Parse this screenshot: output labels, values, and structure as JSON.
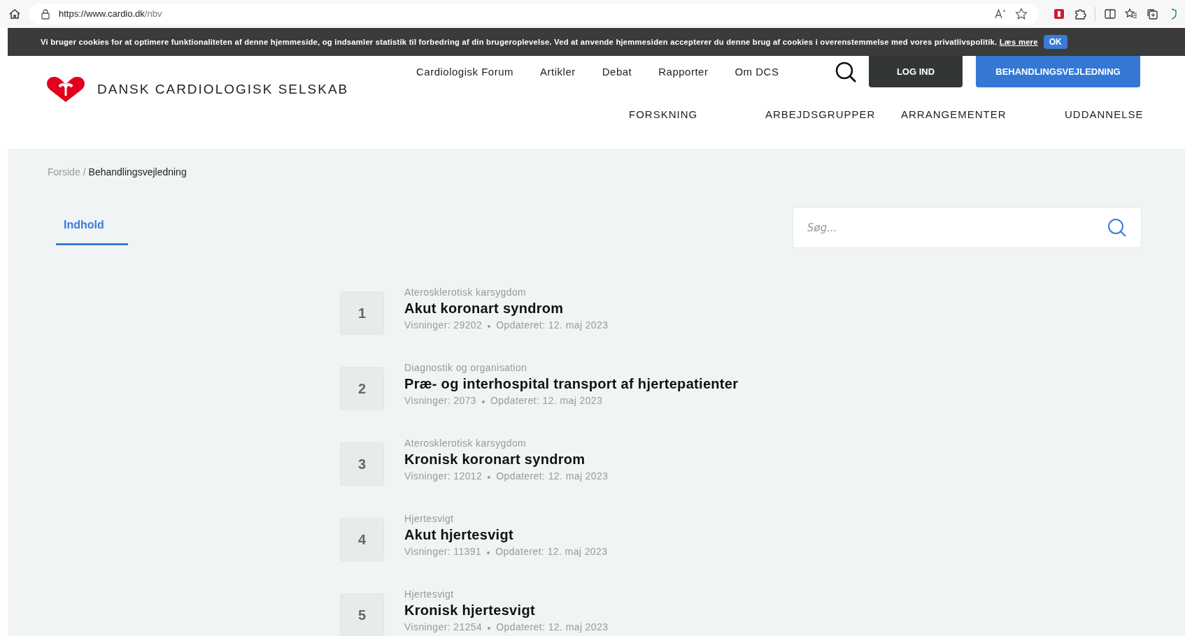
{
  "browser": {
    "url_prefix": "https://www.cardio.dk",
    "url_path": "/nbv"
  },
  "cookie_bar": {
    "text": "Vi bruger cookies for at optimere funktionaliteten af denne hjemmeside, og indsamler statistik til forbedring af din brugeroplevelse. Ved at anvende hjemmesiden accepterer du denne brug af cookies i overenstemmelse med vores privatlivspolitik.",
    "link": "Læs mere",
    "button": "OK"
  },
  "header": {
    "logo_text": "DANSK CARDIOLOGISK SELSKAB",
    "top_nav": [
      "Cardiologisk Forum",
      "Artikler",
      "Debat",
      "Rapporter",
      "Om DCS"
    ],
    "login_button": "LOG IND",
    "primary_button": "BEHANDLINGSVEJLEDNING",
    "main_nav": [
      "FORSKNING",
      "ARBEJDSGRUPPER",
      "ARRANGEMENTER",
      "UDDANNELSE"
    ]
  },
  "breadcrumb": [
    {
      "label": "Forside",
      "current": false
    },
    {
      "label": "Behandlingsvejledning",
      "current": true
    }
  ],
  "breadcrumb_separator": "/",
  "tabs": [
    {
      "label": "Indhold",
      "selected": true
    }
  ],
  "search": {
    "placeholder": "Søg..."
  },
  "guidelines": [
    {
      "number": "1",
      "category": "Aterosklerotisk karsygdom",
      "title": "Akut koronart syndrom",
      "views": "Visninger: 29202",
      "updated": "Opdateret: 12. maj 2023"
    },
    {
      "number": "2",
      "category": "Diagnostik og organisation",
      "title": "Præ- og interhospital transport af hjertepatienter",
      "views": "Visninger: 2073",
      "updated": "Opdateret: 12. maj 2023"
    },
    {
      "number": "3",
      "category": "Aterosklerotisk karsygdom",
      "title": "Kronisk koronart syndrom",
      "views": "Visninger: 12012",
      "updated": "Opdateret: 12. maj 2023"
    },
    {
      "number": "4",
      "category": "Hjertesvigt",
      "title": "Akut hjertesvigt",
      "views": "Visninger: 11391",
      "updated": "Opdateret: 12. maj 2023"
    },
    {
      "number": "5",
      "category": "Hjertesvigt",
      "title": "Kronisk hjertesvigt",
      "views": "Visninger: 21254",
      "updated": "Opdateret: 12. maj 2023"
    }
  ]
}
